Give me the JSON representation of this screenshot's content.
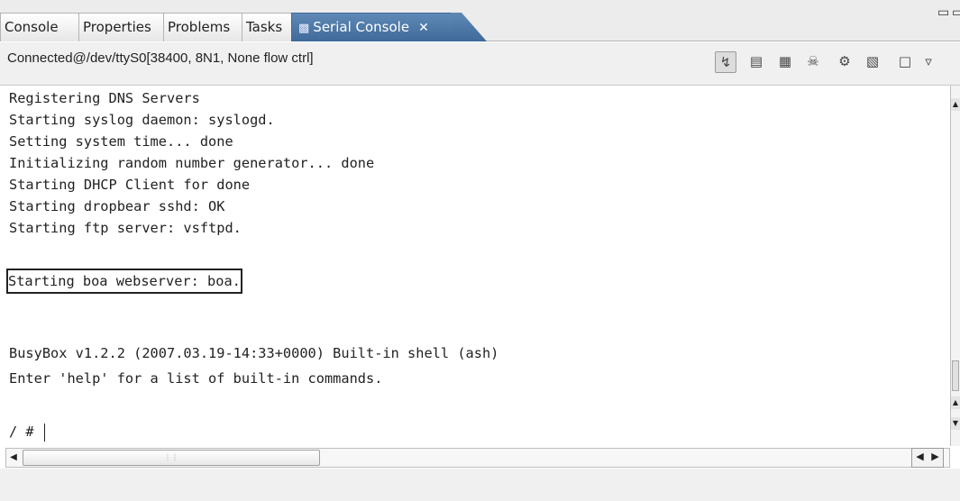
{
  "tabs": [
    {
      "label": "Console",
      "active": false
    },
    {
      "label": "Properties",
      "active": false
    },
    {
      "label": "Problems",
      "active": false
    },
    {
      "label": "Tasks",
      "active": false
    },
    {
      "label": "Serial Console",
      "active": true
    }
  ],
  "active_tab_icon": "serial-port-icon",
  "tab_close_glyph": "✕",
  "window_controls": {
    "minimize": "▭",
    "maximize": "▭"
  },
  "connection_status": "Connected@/dev/ttyS0[38400, 8N1, None flow ctrl]",
  "toolbar_icons": [
    "connect-icon",
    "clear-console-icon",
    "copy-icon",
    "disconnect-icon",
    "settings-icon",
    "capture-icon",
    "new-console-icon",
    "view-menu-icon"
  ],
  "console_lines": [
    "Registering DNS Servers",
    "Starting syslog daemon: syslogd.",
    "Setting system time... done",
    "Initializing random number generator... done",
    "Starting DHCP Client for done",
    "Starting dropbear sshd: OK",
    "Starting ftp server: vsftpd.",
    "Starting boa webserver: boa.",
    "",
    "",
    "BusyBox v1.2.2 (2007.03.19-14:33+0000) Built-in shell (ash)",
    "Enter 'help' for a list of built-in commands.",
    "",
    "/ # "
  ],
  "highlighted_line_index": 7,
  "colors": {
    "active_tab": "#4a75a5",
    "console_background": "#ffffff",
    "console_text": "#222222"
  }
}
